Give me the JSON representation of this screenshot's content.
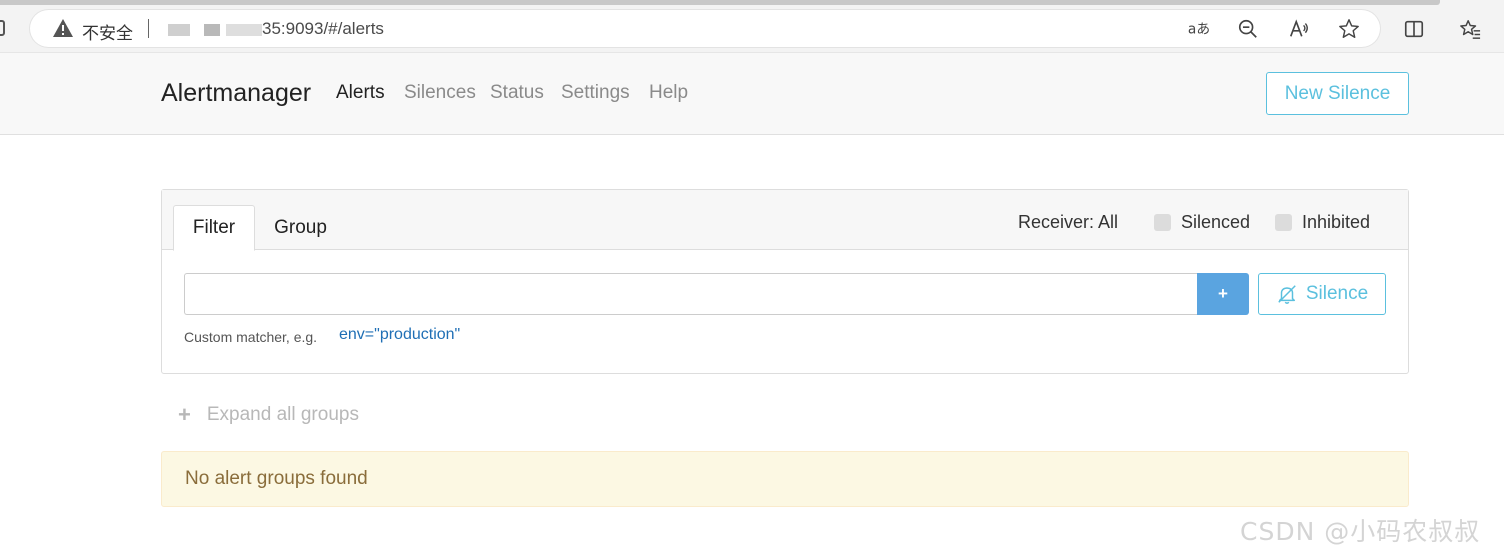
{
  "browser": {
    "insecure_label": "不安全",
    "url": "35:9093/#/alerts"
  },
  "navbar": {
    "brand": "Alertmanager",
    "links": [
      "Alerts",
      "Silences",
      "Status",
      "Settings",
      "Help"
    ],
    "active_link": "Alerts",
    "new_silence_label": "New Silence"
  },
  "filter_card": {
    "tabs": [
      "Filter",
      "Group"
    ],
    "active_tab": "Filter",
    "receiver_label": "Receiver: All",
    "silenced_label": "Silenced",
    "inhibited_label": "Inhibited",
    "input_value": "",
    "add_button_label": "+",
    "silence_button_label": "Silence",
    "helper_text": "Custom matcher, e.g.",
    "helper_example": "env=\"production\""
  },
  "expand_all_label": "Expand all groups",
  "alert_message": "No alert groups found",
  "watermark": "CSDN @小码农叔叔",
  "colors": {
    "info": "#5bc0de",
    "primary": "#5aa4e0",
    "warning_bg": "#fcf8e3",
    "warning_text": "#8a6d3b"
  }
}
